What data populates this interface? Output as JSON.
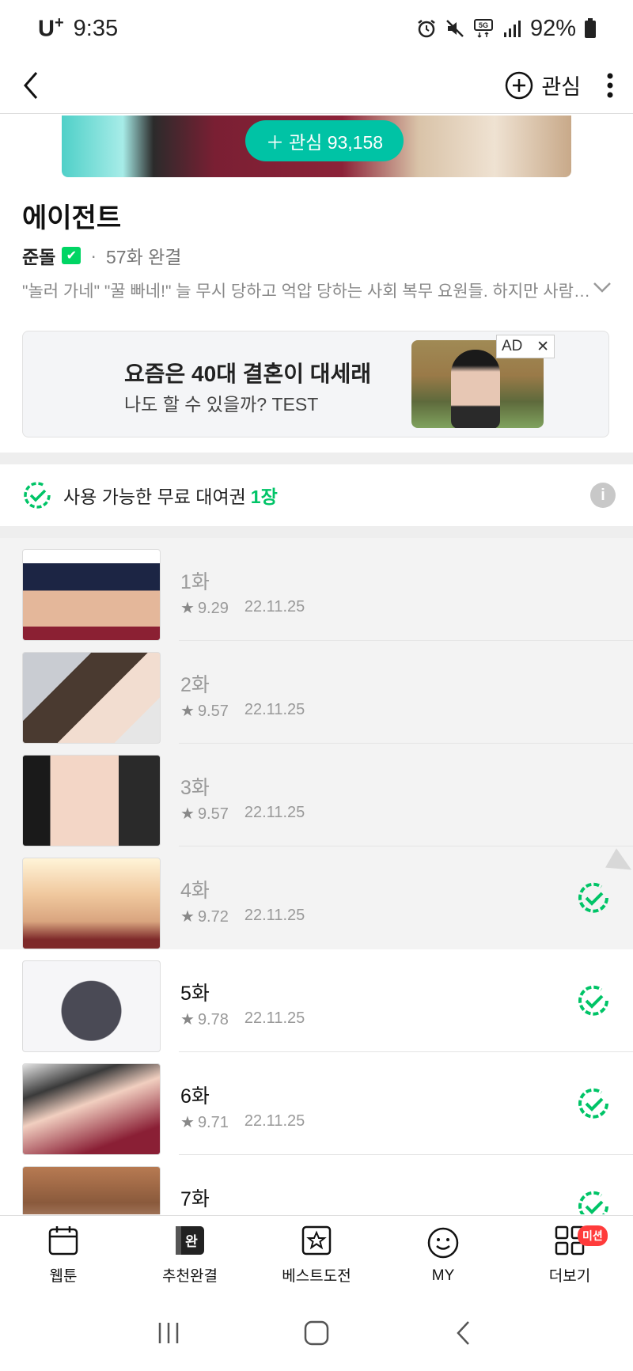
{
  "status": {
    "carrier": "U",
    "carrier_sup": "+",
    "time": "9:35",
    "battery": "92%"
  },
  "nav": {
    "favorite_label": "관심"
  },
  "banner": {
    "favorite_count": "관심 93,158"
  },
  "webtoon": {
    "title": "에이전트",
    "author": "준돌",
    "episode_summary": "57화 완결",
    "description": "\"놀러 가네\" \"꿀 빠네!\" 늘 무시 당하고 억압 당하는 사회 복무 요원들. 하지만 사람들..."
  },
  "ad": {
    "title": "요즘은 40대 결혼이 대세래",
    "subtitle": "나도 할 수 있을까? TEST",
    "badge": "AD"
  },
  "coupon": {
    "text": "사용 가능한 무료 대여권",
    "count": "1장"
  },
  "episodes": [
    {
      "title": "1화",
      "rating": "9.29",
      "date": "22.11.25",
      "read": true,
      "rented": false
    },
    {
      "title": "2화",
      "rating": "9.57",
      "date": "22.11.25",
      "read": true,
      "rented": false
    },
    {
      "title": "3화",
      "rating": "9.57",
      "date": "22.11.25",
      "read": true,
      "rented": false
    },
    {
      "title": "4화",
      "rating": "9.72",
      "date": "22.11.25",
      "read": true,
      "rented": true
    },
    {
      "title": "5화",
      "rating": "9.78",
      "date": "22.11.25",
      "read": false,
      "rented": true
    },
    {
      "title": "6화",
      "rating": "9.71",
      "date": "22.11.25",
      "read": false,
      "rented": true
    },
    {
      "title": "7화",
      "rating": "",
      "date": "",
      "read": false,
      "rented": true
    }
  ],
  "bottom_nav": [
    {
      "label": "웹툰",
      "icon": "calendar-icon"
    },
    {
      "label": "추천완결",
      "icon": "completed-icon",
      "icon_text": "완"
    },
    {
      "label": "베스트도전",
      "icon": "star-box-icon"
    },
    {
      "label": "MY",
      "icon": "smile-icon"
    },
    {
      "label": "더보기",
      "icon": "grid-icon",
      "badge": "미션"
    }
  ],
  "colors": {
    "accent_green": "#00c467",
    "banner_pill": "#00c3a5",
    "badge_red": "#ff3b3b"
  }
}
